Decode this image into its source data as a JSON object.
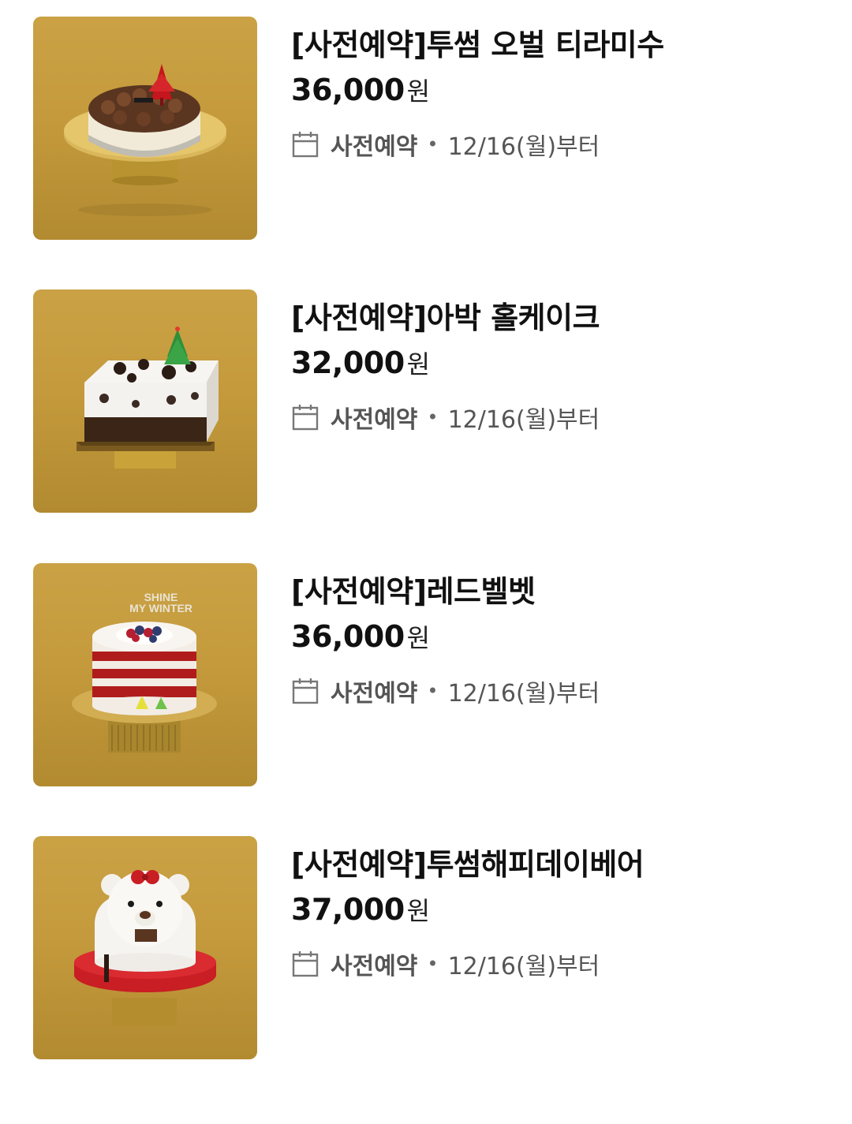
{
  "products": [
    {
      "title": "[사전예약]투썸 오벌 티라미수",
      "price": "36,000",
      "currency": "원",
      "reserve_label": "사전예약",
      "separator": "•",
      "available_from": "12/16(월)부터",
      "image_icon": "tiramisu-cake-image"
    },
    {
      "title": "[사전예약]아박 홀케이크",
      "price": "32,000",
      "currency": "원",
      "reserve_label": "사전예약",
      "separator": "•",
      "available_from": "12/16(월)부터",
      "image_icon": "cookies-cream-cake-image"
    },
    {
      "title": "[사전예약]레드벨벳",
      "price": "36,000",
      "currency": "원",
      "reserve_label": "사전예약",
      "separator": "•",
      "available_from": "12/16(월)부터",
      "image_icon": "red-velvet-cake-image",
      "image_text": "SHINE MY WINTER"
    },
    {
      "title": "[사전예약]투썸해피데이베어",
      "price": "37,000",
      "currency": "원",
      "reserve_label": "사전예약",
      "separator": "•",
      "available_from": "12/16(월)부터",
      "image_icon": "bear-cake-image"
    }
  ],
  "colors": {
    "title": "#111111",
    "meta": "#555555",
    "thumb_gold": "#c49a3c"
  }
}
